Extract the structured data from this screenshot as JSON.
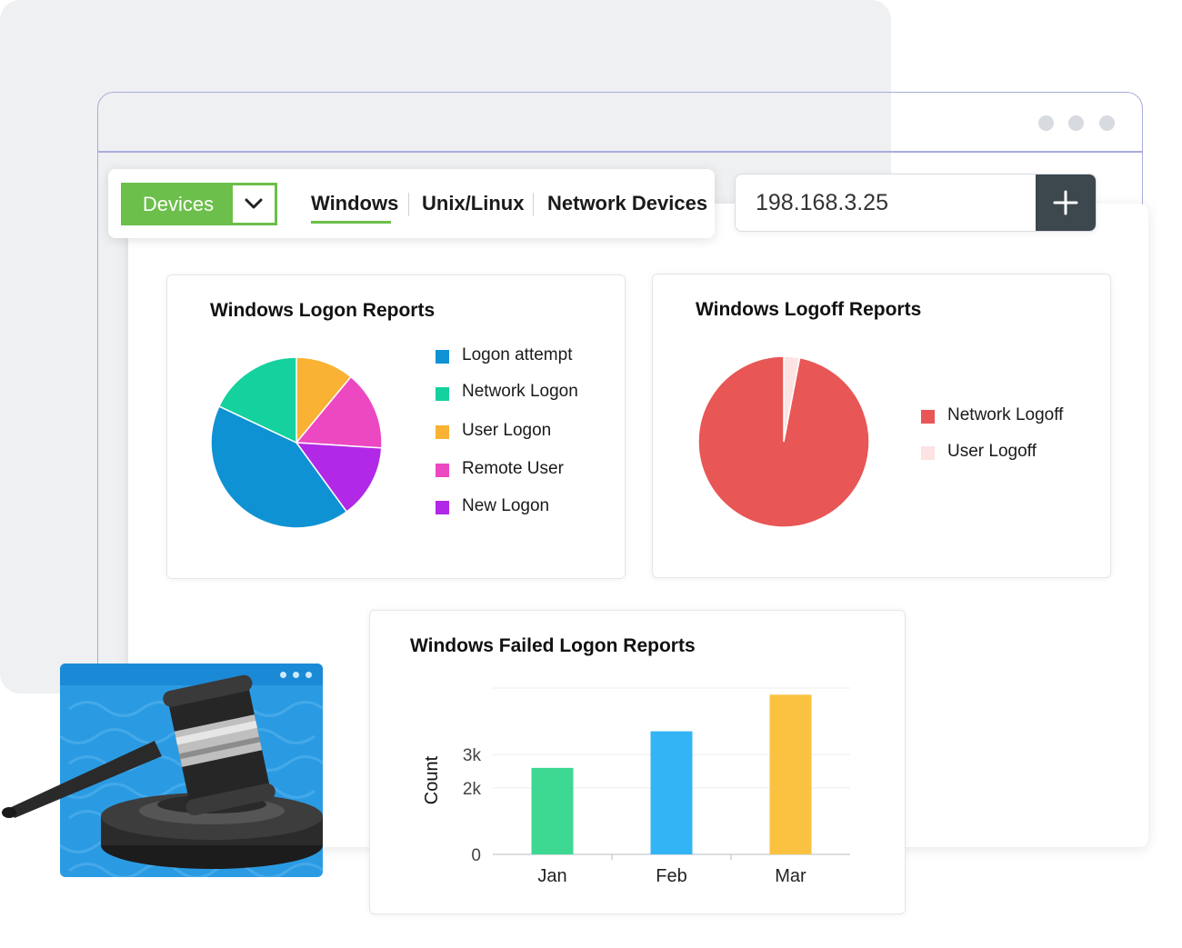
{
  "toolbar": {
    "dropdown_label": "Devices",
    "tabs": [
      {
        "label": "Windows",
        "active": true
      },
      {
        "label": "Unix/Linux",
        "active": false
      },
      {
        "label": "Network Devices",
        "active": false
      }
    ]
  },
  "search": {
    "ip_value": "198.168.3.25",
    "add_label": "+"
  },
  "colors": {
    "accent_green": "#6cbf4a",
    "add_button": "#3c474e"
  },
  "icons": [
    "chevron-down-icon",
    "plus-icon",
    "window-dots-icon",
    "gavel-icon"
  ],
  "chart_data": [
    {
      "type": "pie",
      "title": "Windows Logon Reports",
      "labels": [
        "Logon attempt",
        "Network Logon",
        "User Logon",
        "Remote User",
        "New Logon"
      ],
      "values": [
        42,
        18,
        11,
        15,
        14
      ],
      "colors": [
        "#0f92d3",
        "#14d19e",
        "#f9b233",
        "#ec48c2",
        "#b129e6"
      ],
      "legend": "right"
    },
    {
      "type": "pie",
      "title": "Windows Logoff Reports",
      "labels": [
        "Network Logoff",
        "User Logoff"
      ],
      "values": [
        97,
        3
      ],
      "colors": [
        "#e85656",
        "#fde3e3"
      ],
      "legend": "right"
    },
    {
      "type": "bar",
      "title": "Windows Failed Logon Reports",
      "categories": [
        "Jan",
        "Feb",
        "Mar"
      ],
      "values": [
        2600,
        3700,
        4800
      ],
      "colors": [
        "#3dd891",
        "#33b5f5",
        "#fbc241"
      ],
      "ylabel": "Count",
      "yticks": [
        "0",
        "2k",
        "3k"
      ],
      "ytick_values": [
        0,
        2000,
        3000
      ],
      "ylim": [
        0,
        5000
      ],
      "grid": true
    }
  ]
}
